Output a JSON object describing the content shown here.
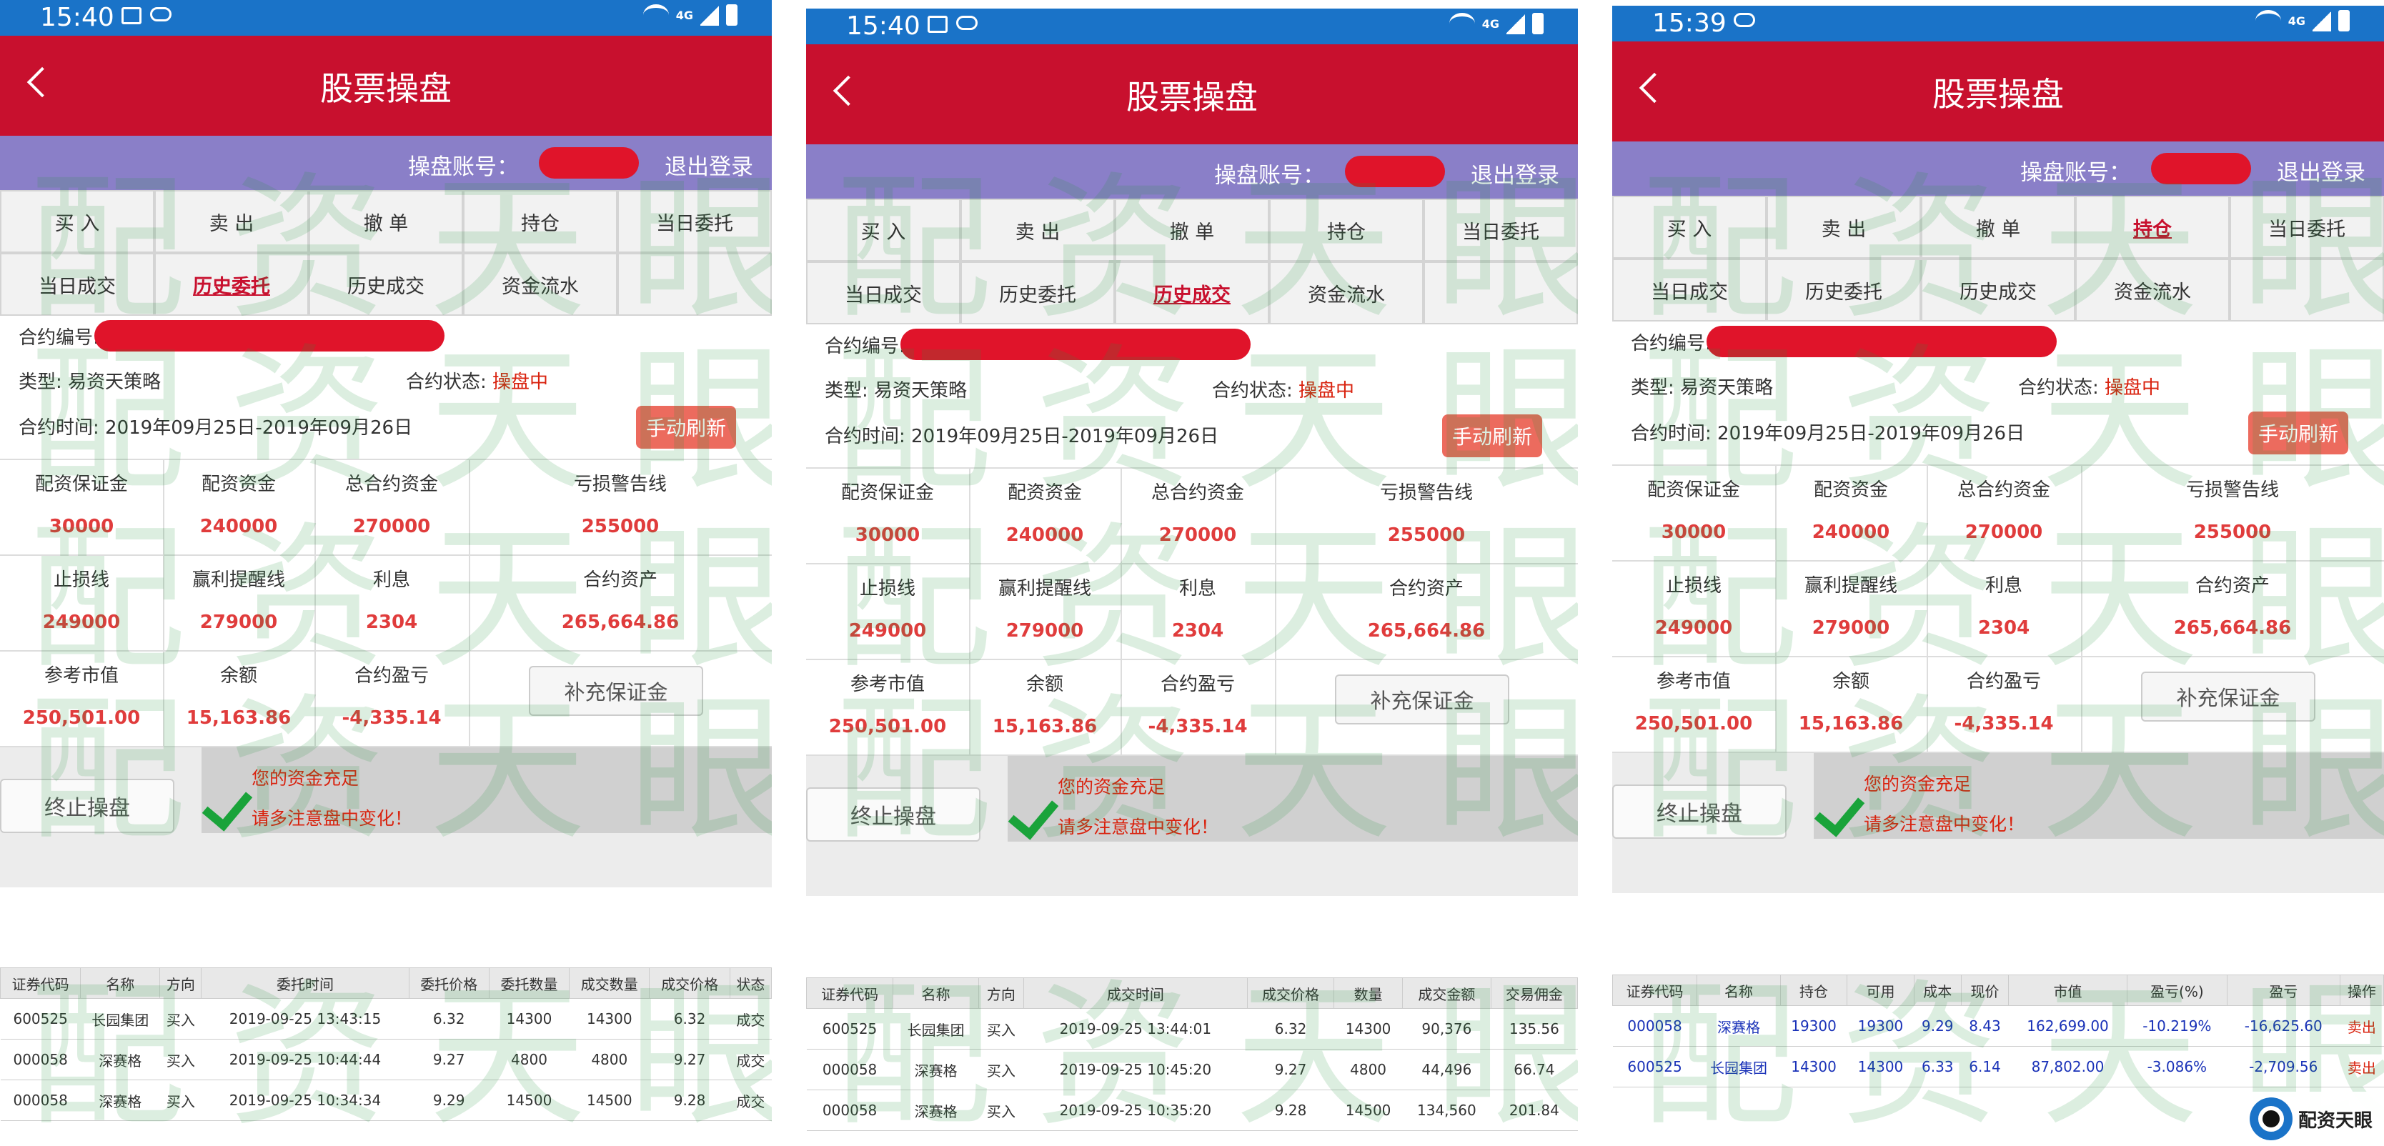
{
  "statusbars": [
    {
      "time": "15:40"
    },
    {
      "time": "15:40"
    },
    {
      "time": "15:39"
    }
  ],
  "status": {
    "net": "4G"
  },
  "page_title": "股票操盘",
  "account_label": "操盘账号：",
  "logout_label": "退出登录",
  "tabs": [
    "买 入",
    "卖 出",
    "撤 单",
    "持仓",
    "当日委托",
    "当日成交",
    "历史委托",
    "历史成交",
    "资金流水",
    ""
  ],
  "active_tabs": [
    "历史委托",
    "历史成交",
    "持仓"
  ],
  "contract": {
    "id_label": "合约编号:",
    "type_label": "类型:",
    "type_value": "易资天策略",
    "state_label": "合约状态:",
    "state_value": "操盘中",
    "time_label": "合约时间:",
    "time_value": "2019年09月25日-2019年09月26日",
    "refresh_button": "手动刷新"
  },
  "metrics": {
    "row1": [
      {
        "label": "配资保证金",
        "value": "30000"
      },
      {
        "label": "配资资金",
        "value": "240000"
      },
      {
        "label": "总合约资金",
        "value": "270000"
      },
      {
        "label": "亏损警告线",
        "value": "255000"
      }
    ],
    "row2": [
      {
        "label": "止损线",
        "value": "249000"
      },
      {
        "label": "赢利提醒线",
        "value": "279000"
      },
      {
        "label": "利息",
        "value": "2304"
      },
      {
        "label": "合约资产",
        "value": "265,664.86"
      }
    ],
    "row3": [
      {
        "label": "参考市值",
        "value": "250,501.00"
      },
      {
        "label": "余额",
        "value": "15,163.86"
      },
      {
        "label": "合约盈亏",
        "value": "-4,335.14"
      }
    ],
    "add_margin_button": "补充保证金"
  },
  "stop_button": "终止操盘",
  "alert": {
    "line1": "您的资金充足",
    "line2": "请多注意盘中变化！"
  },
  "table_entrust": {
    "headers": [
      "证券代码",
      "名称",
      "方向",
      "委托时间",
      "委托价格",
      "委托数量",
      "成交数量",
      "成交价格",
      "状态"
    ],
    "rows": [
      [
        "600525",
        "长园集团",
        "买入",
        "2019-09-25 13:43:15",
        "6.32",
        "14300",
        "14300",
        "6.32",
        "成交"
      ],
      [
        "000058",
        "深赛格",
        "买入",
        "2019-09-25 10:44:44",
        "9.27",
        "4800",
        "4800",
        "9.27",
        "成交"
      ],
      [
        "000058",
        "深赛格",
        "买入",
        "2019-09-25 10:34:34",
        "9.29",
        "14500",
        "14500",
        "9.28",
        "成交"
      ]
    ]
  },
  "table_deals": {
    "headers": [
      "证券代码",
      "名称",
      "方向",
      "成交时间",
      "成交价格",
      "数量",
      "成交金额",
      "交易佣金"
    ],
    "rows": [
      [
        "600525",
        "长园集团",
        "买入",
        "2019-09-25 13:44:01",
        "6.32",
        "14300",
        "90,376",
        "135.56"
      ],
      [
        "000058",
        "深赛格",
        "买入",
        "2019-09-25 10:45:20",
        "9.27",
        "4800",
        "44,496",
        "66.74"
      ],
      [
        "000058",
        "深赛格",
        "买入",
        "2019-09-25 10:35:20",
        "9.28",
        "14500",
        "134,560",
        "201.84"
      ]
    ]
  },
  "table_positions": {
    "headers": [
      "证券代码",
      "名称",
      "持仓",
      "可用",
      "成本",
      "现价",
      "市值",
      "盈亏(%)",
      "盈亏",
      "操作"
    ],
    "rows": [
      [
        "000058",
        "深赛格",
        "19300",
        "19300",
        "9.29",
        "8.43",
        "162,699.00",
        "-10.219%",
        "-16,625.60",
        "卖出"
      ],
      [
        "600525",
        "长园集团",
        "14300",
        "14300",
        "6.33",
        "6.14",
        "87,802.00",
        "-3.086%",
        "-2,709.56",
        "卖出"
      ]
    ]
  },
  "watermark": "配资天眼",
  "logo_text": "配资天眼"
}
